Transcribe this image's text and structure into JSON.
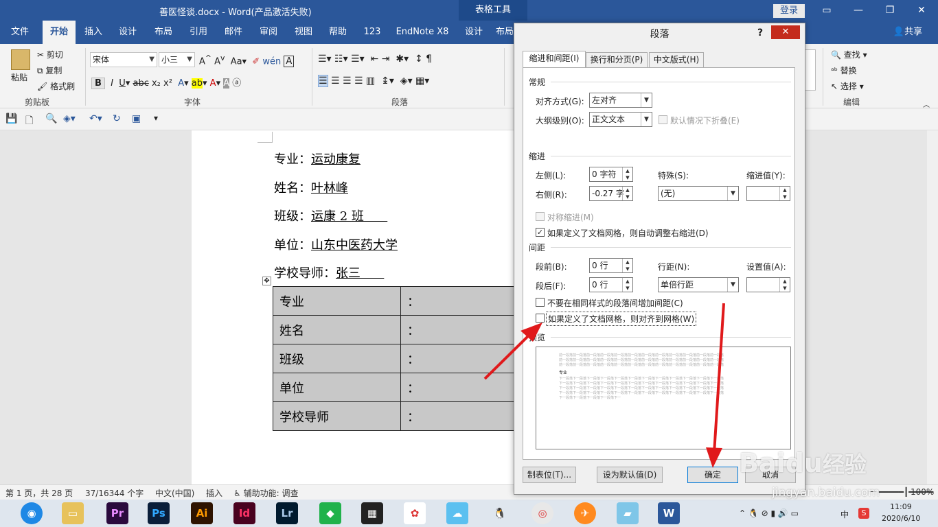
{
  "window": {
    "title": "善医怪谈.docx  -  Word(产品激活失败)",
    "context_tab": "表格工具",
    "login": "登录",
    "share": "共享"
  },
  "ribbon_tabs": [
    "文件",
    "开始",
    "插入",
    "设计",
    "布局",
    "引用",
    "邮件",
    "审阅",
    "视图",
    "帮助",
    "123",
    "EndNote X8",
    "设计",
    "布局"
  ],
  "ribbon": {
    "clipboard": {
      "paste": "粘贴",
      "cut": "剪切",
      "copy": "复制",
      "format_painter": "格式刷",
      "label": "剪贴板"
    },
    "font": {
      "name": "宋体",
      "size": "小三",
      "label": "字体"
    },
    "paragraph": {
      "label": "段落"
    },
    "editing": {
      "find": "查找",
      "replace": "替换",
      "select": "选择",
      "label": "编辑"
    }
  },
  "document": {
    "lines": [
      {
        "key": "专业：",
        "value": "运动康复"
      },
      {
        "key": "姓名：",
        "value": "叶林峰"
      },
      {
        "key": "班级：",
        "value": "运康 2 班      "
      },
      {
        "key": "单位：",
        "value": "山东中医药大学"
      },
      {
        "key": "学校导师：",
        "value": "张三      "
      }
    ],
    "table": [
      {
        "label": "专业",
        "sep": "："
      },
      {
        "label": "姓名",
        "sep": "："
      },
      {
        "label": "班级",
        "sep": "："
      },
      {
        "label": "单位",
        "sep": "："
      },
      {
        "label": "学校导师",
        "sep": "："
      }
    ]
  },
  "status": {
    "page": "第 1 页，共 28 页",
    "words": "37/16344 个字",
    "lang": "中文(中国)",
    "mode": "插入",
    "access": "辅助功能: 调查",
    "zoom": "100%"
  },
  "taskbar": {
    "ime": "中",
    "time": "11:09",
    "date": "2020/6/10"
  },
  "dialog": {
    "title": "段落",
    "help": "?",
    "tabs": [
      "缩进和间距(I)",
      "换行和分页(P)",
      "中文版式(H)"
    ],
    "general": {
      "section": "常规",
      "align_label": "对齐方式(G):",
      "align_value": "左对齐",
      "outline_label": "大纲级别(O):",
      "outline_value": "正文文本",
      "collapse": "默认情况下折叠(E)"
    },
    "indent": {
      "section": "缩进",
      "left_label": "左侧(L):",
      "left_value": "0 字符",
      "right_label": "右侧(R):",
      "right_value": "-0.27 字",
      "special_label": "特殊(S):",
      "special_value": "(无)",
      "value_label": "缩进值(Y):",
      "mirror": "对称缩进(M)",
      "auto_adjust": "如果定义了文档网格，则自动调整右缩进(D)"
    },
    "spacing": {
      "section": "间距",
      "before_label": "段前(B):",
      "before_value": "0 行",
      "after_label": "段后(F):",
      "after_value": "0 行",
      "line_label": "行距(N):",
      "line_value": "单倍行距",
      "set_label": "设置值(A):",
      "no_space": "不要在相同样式的段落间增加间距(C)",
      "snap_grid": "如果定义了文档网格，则对齐到网格(W)"
    },
    "preview": {
      "section": "预览",
      "prev_text": "前一段落前一段落前一段落前一段落前一段落前一段落前一段落前一段落前一段落前一段落前一段落前一段落",
      "sample": "专业",
      "next_text": "下一段落下一段落下一段落下一段落下一段落下一段落下一段落下一段落下一段落下一段落下一段落下一段落"
    },
    "buttons": {
      "tabs": "制表位(T)...",
      "default": "设为默认值(D)",
      "ok": "确定",
      "cancel": "取消"
    }
  },
  "watermark": {
    "brand": "Baidu",
    "cn": "经验",
    "url": "jingyan.baidu.com"
  },
  "colors": {
    "word_blue": "#2b579a",
    "close_red": "#c42b1c",
    "arrow_red": "#e0191b"
  }
}
